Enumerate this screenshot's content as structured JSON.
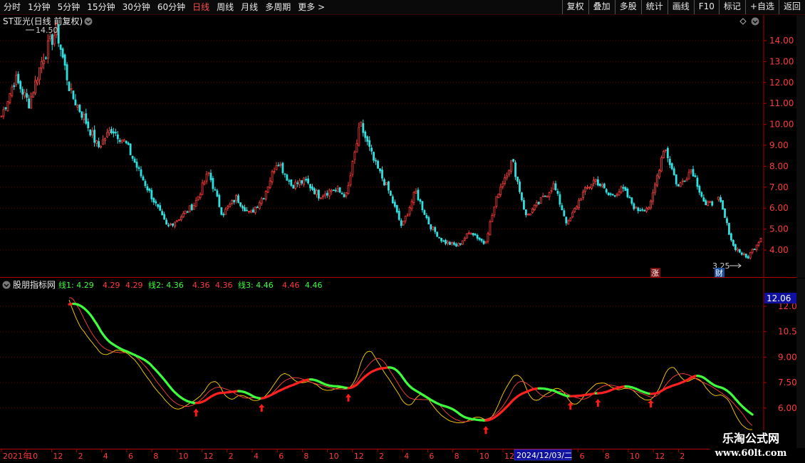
{
  "toolbar": {
    "periods": [
      "分时",
      "1分钟",
      "5分钟",
      "15分钟",
      "30分钟",
      "60分钟",
      "日线",
      "周线",
      "月线",
      "多周期",
      "更多 >"
    ],
    "active_index": 6,
    "right_buttons": [
      "复权",
      "叠加",
      "多股",
      "统计",
      "画线",
      "F10",
      "标记",
      "+自选",
      "返回"
    ]
  },
  "main": {
    "title": "ST亚光(日线 前复权)",
    "high_label": "14.50",
    "low_label": "3.25",
    "y_ticks": [
      "14.00",
      "13.00",
      "12.00",
      "11.00",
      "10.00",
      "9.00",
      "8.00",
      "7.00",
      "6.00",
      "5.00",
      "4.00"
    ],
    "badge_zhang": "涨",
    "badge_cai": "财"
  },
  "indicator": {
    "title": "股朋指标网",
    "readouts": [
      {
        "text": "线1: 4.29",
        "color": "#3dff3d"
      },
      {
        "text": "4.29",
        "color": "#ff3b3b"
      },
      {
        "text": "4.29",
        "color": "#ff3b3b"
      },
      {
        "text": "线2: 4.36",
        "color": "#3dff3d"
      },
      {
        "text": "4.36",
        "color": "#ff3b3b"
      },
      {
        "text": "4.36",
        "color": "#ff3b3b"
      },
      {
        "text": "线3: 4.46",
        "color": "#3dff3d"
      },
      {
        "text": "4.46",
        "color": "#ff3b3b"
      },
      {
        "text": "4.46",
        "color": "#3dff3d"
      }
    ],
    "current_value": "12.06",
    "y_ticks": [
      "12.00",
      "10.50",
      "9.00",
      "7.50",
      "6.00"
    ]
  },
  "time_axis": {
    "labels": [
      "2021年",
      "10",
      "12",
      "2",
      "4",
      "6",
      "8",
      "10",
      "12",
      "2",
      "4",
      "6",
      "8",
      "10",
      "12",
      "2",
      "4",
      "6",
      "8",
      "10",
      "12",
      "2",
      "4",
      "6",
      "8",
      "10",
      "12",
      "2"
    ],
    "highlight": "2024/12/03/二"
  },
  "watermark": {
    "line1": "乐淘公式网",
    "line2": "www.60lt.com"
  },
  "colors": {
    "up": "#ff3b3b",
    "down": "#2fe0e0",
    "grid": "#7a0000",
    "axis": "#b00000",
    "line_green": "#3dff3d",
    "line_red": "#ff2020",
    "highlight_bg": "#1010a0"
  },
  "chart_data": {
    "type": "candlestick",
    "ylim": [
      3.25,
      14.5
    ],
    "close_path": [
      10.4,
      12.2,
      11.0,
      13.2,
      14.5,
      11.5,
      10.3,
      8.9,
      9.8,
      9.1,
      7.7,
      6.4,
      5.1,
      5.6,
      6.2,
      7.7,
      5.7,
      6.5,
      5.7,
      6.6,
      8.3,
      7.1,
      7.3,
      6.6,
      6.9,
      6.6,
      10.0,
      8.2,
      6.9,
      5.1,
      6.8,
      5.2,
      4.4,
      4.2,
      4.9,
      4.3,
      6.8,
      8.3,
      5.6,
      6.3,
      7.1,
      5.2,
      6.6,
      7.4,
      6.6,
      6.9,
      5.9,
      6.1,
      9.0,
      7.0,
      7.9,
      6.1,
      6.4,
      4.2,
      3.6,
      4.6
    ]
  }
}
